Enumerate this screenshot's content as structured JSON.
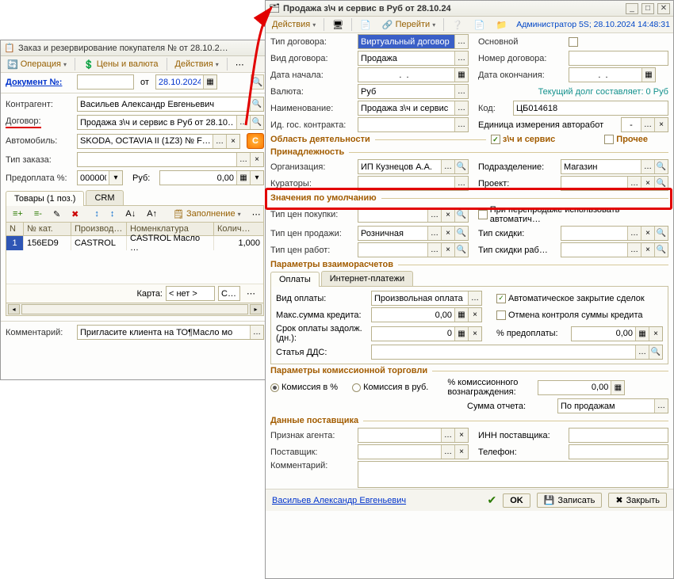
{
  "left": {
    "title": "Заказ и резервирование покупателя №  от 28.10.2…",
    "toolbar": {
      "op": "Операция",
      "price": "Цены и валюта",
      "act": "Действия"
    },
    "doc_label": "Документ №:",
    "doc_value": "",
    "ot": "от",
    "date": "28.10.2024",
    "rows": {
      "contragent": {
        "label": "Контрагент:",
        "value": "Васильев Александр Евгеньевич"
      },
      "dogovor": {
        "label": "Договор:",
        "value": "Продажа з\\ч и сервис в Руб от 28.10…"
      },
      "auto": {
        "label": "Автомобиль:",
        "value": "SKODA, OCTAVIA II (1Z3) № F…"
      },
      "type": {
        "label": "Тип заказа:",
        "value": ""
      },
      "prepay": {
        "label": "Предоплата %:",
        "value": "0000000",
        "cur": "Руб:",
        "sum": "0,00"
      }
    },
    "tabs": {
      "goods": "Товары (1 поз.)",
      "crm": "CRM"
    },
    "toolbar2": {
      "fill": "Заполнение"
    },
    "grid": {
      "headers": [
        "N",
        "№ кат.",
        "Производ…",
        "Номенклатура",
        "Колич…"
      ],
      "row": [
        "1",
        "156ED9",
        "CASTROL",
        "CASTROL Масло …",
        "1,000"
      ]
    },
    "karta": {
      "label": "Карта:",
      "value": "< нет >",
      "c": "С…"
    },
    "comment": {
      "label": "Комментарий:",
      "value": "Пригласите клиента на ТО¶Масло мо"
    }
  },
  "right": {
    "title": "Продажа з\\ч и сервис в Руб от 28.10.24",
    "toolbar": {
      "act": "Действия",
      "go": "Перейти",
      "status": "Администратор 5S; 28.10.2024 14:48:31"
    },
    "fields": {
      "tip_dog": {
        "l": "Тип договора:",
        "v": "Виртуальный договор"
      },
      "osnov": {
        "l": "Основной"
      },
      "vid_dog": {
        "l": "Вид договора:",
        "v": "Продажа"
      },
      "nomer": {
        "l": "Номер договора:",
        "v": ""
      },
      "dn": {
        "l": "Дата начала:",
        "v": ""
      },
      "do": {
        "l": "Дата окончания:",
        "v": ""
      },
      "val": {
        "l": "Валюта:",
        "v": "Руб"
      },
      "dolg": "Текущий долг составляет: 0 Руб",
      "naim": {
        "l": "Наименование:",
        "v": "Продажа з\\ч и сервис"
      },
      "kod": {
        "l": "Код:",
        "v": "ЦБ014618"
      },
      "idgos": {
        "l": "Ид. гос. контракта:",
        "v": ""
      },
      "edizm": {
        "l": "Единица измерения авторабот",
        "v": "-"
      }
    },
    "sec_oblast": "Область деятельности",
    "cb_zch": "з\\ч и сервис",
    "cb_prochee": "Прочее",
    "sec_prinad": "Принадлежность",
    "org": {
      "l": "Организация:",
      "v": "ИП Кузнецов А.А."
    },
    "podr": {
      "l": "Подразделение:",
      "v": "Магазин"
    },
    "kurat": {
      "l": "Кураторы:",
      "v": ""
    },
    "proj": {
      "l": "Проект:",
      "v": ""
    },
    "sec_znach": "Значения по умолчанию",
    "tcp": {
      "l": "Тип цен покупки:",
      "v": ""
    },
    "pereprod": "При перепродаже использовать автоматич…",
    "tcs": {
      "l": "Тип цен продажи:",
      "v": "Розничная"
    },
    "tskid": {
      "l": "Тип скидки:",
      "v": ""
    },
    "tcr": {
      "l": "Тип цен работ:",
      "v": ""
    },
    "tsr": {
      "l": "Тип скидки раб…",
      "v": ""
    },
    "sec_param": "Параметры взаиморасчетов",
    "tabs": {
      "opl": "Оплаты",
      "inet": "Интернет-платежи"
    },
    "vid_opl": {
      "l": "Вид оплаты:",
      "v": "Произвольная оплата"
    },
    "auto_close": "Автоматическое закрытие сделок",
    "maxsum": {
      "l": "Макс.сумма кредита:",
      "v": "0,00"
    },
    "otmena": "Отмена контроля суммы кредита",
    "srok": {
      "l": "Срок оплаты задолж. (дн.):",
      "v": "0"
    },
    "pctpre": {
      "l": "% предоплаты:",
      "v": "0,00"
    },
    "dds": {
      "l": "Статья ДДС:",
      "v": ""
    },
    "sec_kom": "Параметры комиссионной торговли",
    "kom_pct": "Комиссия в %",
    "kom_rub": "Комиссия в руб.",
    "kom_vozn": {
      "l": "% комиссионного вознаграждения:",
      "v": "0,00"
    },
    "sum_otch": {
      "l": "Сумма отчета:",
      "v": "По продажам"
    },
    "sec_supp": "Данные поставщика",
    "pagent": {
      "l": "Признак агента:",
      "v": ""
    },
    "inn": {
      "l": "ИНН поставщика:",
      "v": ""
    },
    "supp": {
      "l": "Поставщик:",
      "v": ""
    },
    "tel": {
      "l": "Телефон:",
      "v": ""
    },
    "komm": {
      "l": "Комментарий:",
      "v": ""
    },
    "owner_link": "Васильев Александр Евгеньевич",
    "btn_ok": "OK",
    "btn_save": "Записать",
    "btn_close": "Закрыть"
  }
}
